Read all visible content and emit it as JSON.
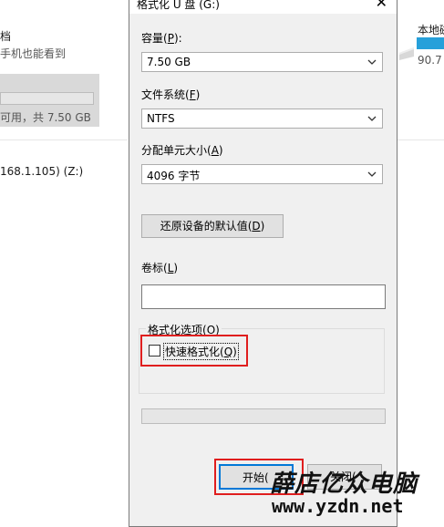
{
  "background": {
    "left_item_title": "档",
    "left_item_sub": "手机也能看到",
    "left_item_free": "可用，共 7.50 GB",
    "network_drive": "168.1.105) (Z:)",
    "right_drive_label": "本地磁",
    "right_drive_size": "90.7"
  },
  "dialog": {
    "title": "格式化 U 盘 (G:)",
    "capacity": {
      "label": "容量(",
      "key": "P",
      "label_end": "):",
      "value": "7.50 GB"
    },
    "filesystem": {
      "label": "文件系统(",
      "key": "F",
      "label_end": ")",
      "value": "NTFS"
    },
    "allocation": {
      "label": "分配单元大小(",
      "key": "A",
      "label_end": ")",
      "value": "4096 字节"
    },
    "restore_button": {
      "label": "还原设备的默认值(",
      "key": "D",
      "label_end": ")"
    },
    "volume": {
      "label": "卷标(",
      "key": "L",
      "label_end": ")",
      "value": ""
    },
    "options_group": {
      "label": "格式化选项(",
      "key": "O",
      "label_end": ")"
    },
    "quick_format": {
      "label": "快速格式化(",
      "key": "Q",
      "label_end": ")",
      "checked": false
    },
    "progress": 0,
    "start_button": {
      "label": "开始("
    },
    "close_button": {
      "label": "关闭("
    }
  },
  "watermark": {
    "text": "薛店亿众电脑",
    "url": "www.yzdn.net"
  },
  "colors": {
    "highlight": "#e01e1e",
    "drive_bar": "#26a0da"
  }
}
